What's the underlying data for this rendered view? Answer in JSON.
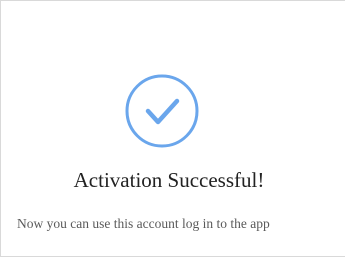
{
  "status": {
    "icon": "check-circle-icon",
    "accent_color": "#6aa6ec",
    "title": "Activation Successful!",
    "message": "Now you can use this account log in to the app"
  }
}
